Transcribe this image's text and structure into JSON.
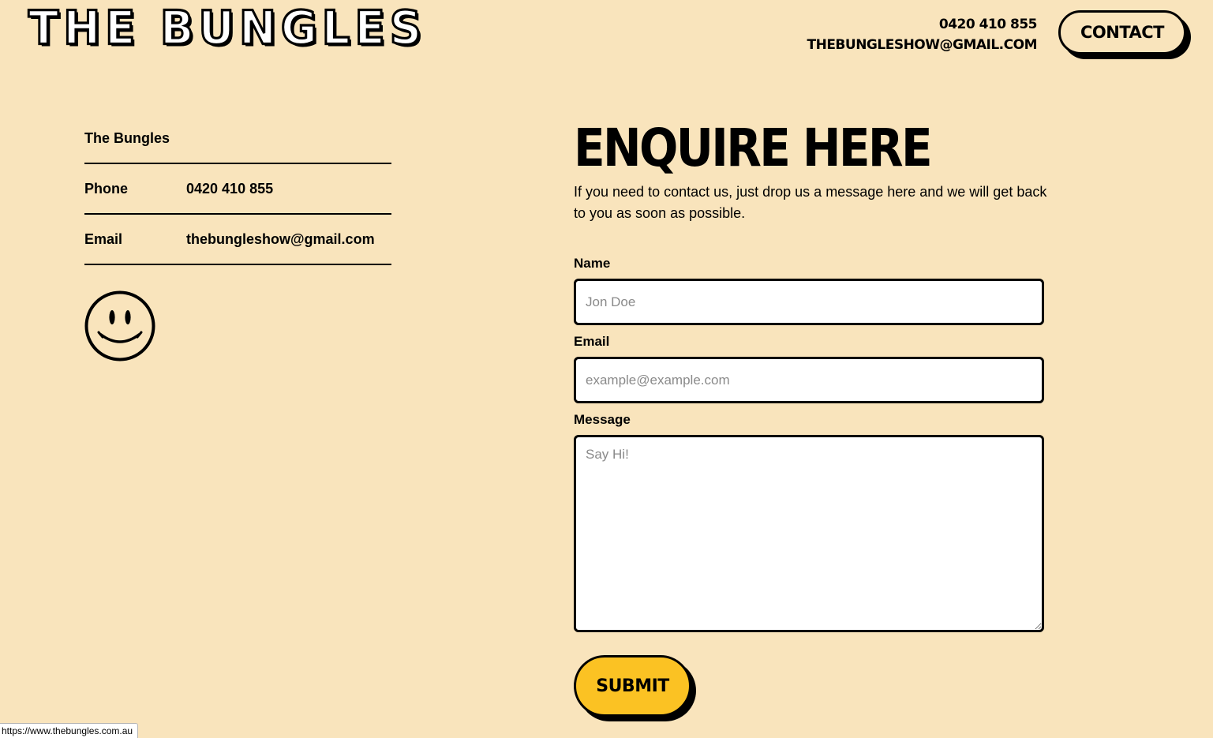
{
  "header": {
    "logo_text": "THE BUNGLES",
    "phone": "0420 410 855",
    "email": "THEBUNGLESHOW@GMAIL.COM",
    "contact_button": "CONTACT"
  },
  "info": {
    "name": "The Bungles",
    "phone_label": "Phone",
    "phone_value": "0420 410 855",
    "email_label": "Email",
    "email_value": "thebungleshow@gmail.com"
  },
  "form": {
    "title": "ENQUIRE HERE",
    "intro": "If you need to contact us, just drop us a message here and we will get back to you as soon as possible.",
    "name_label": "Name",
    "name_placeholder": "Jon Doe",
    "email_label": "Email",
    "email_placeholder": "example@example.com",
    "message_label": "Message",
    "message_placeholder": "Say Hi!",
    "submit_label": "SUBMIT"
  },
  "status_bar": {
    "url": "https://www.thebungles.com.au"
  },
  "colors": {
    "background": "#f9e4bc",
    "accent": "#fbc223",
    "ink": "#000000"
  }
}
